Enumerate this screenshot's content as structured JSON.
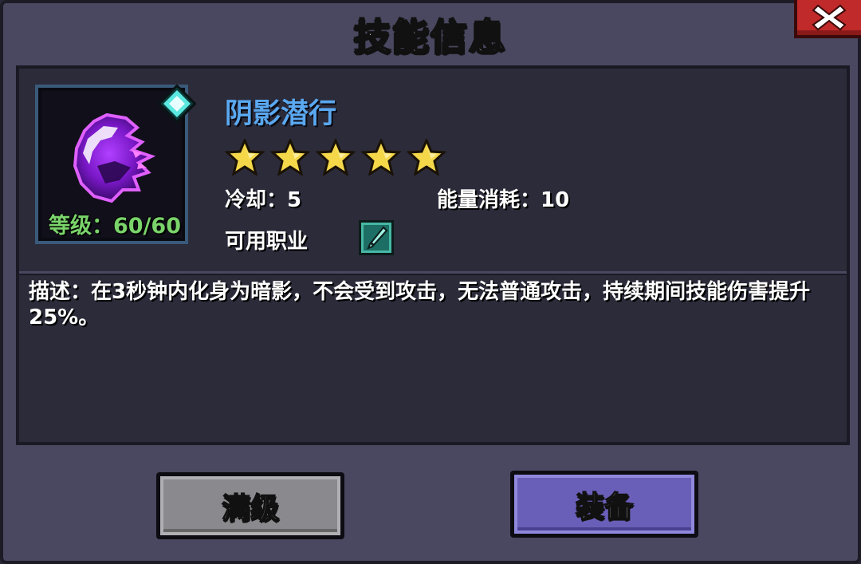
{
  "dialog": {
    "title": "技能信息",
    "close_icon": "close-icon"
  },
  "skill": {
    "name": "阴影潜行",
    "level_label": "等级：60/60",
    "stars": 5,
    "stars_max": 5,
    "cooldown_label": "冷却：5",
    "energy_label": "能量消耗：10",
    "class_label": "可用职业",
    "class_icon": "sword-icon",
    "description": "描述：在3秒钟内化身为暗影，不会受到攻击，无法普通攻击，持续期间技能伤害提升25%。"
  },
  "buttons": {
    "max_level": "满级",
    "equip": "装备"
  },
  "colors": {
    "skill_name": "#5aa8f0",
    "level": "#7ad46a",
    "star": "#f5d84a",
    "max_button": "#8a8a8e",
    "equip_button": "#6a5fb8",
    "close_button": "#c02a2a"
  }
}
